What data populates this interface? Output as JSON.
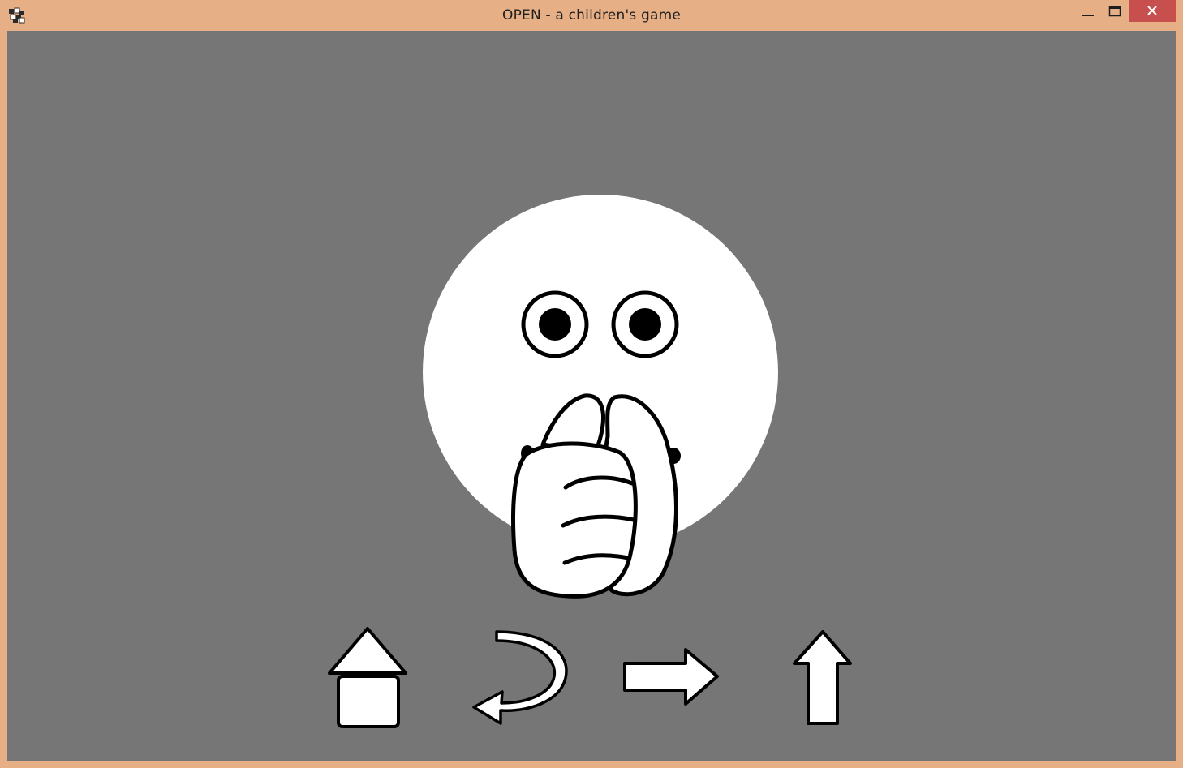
{
  "window": {
    "title": "OPEN - a children's game",
    "controls": [
      "minimize",
      "maximize",
      "close"
    ],
    "accent_color": "#e6af86",
    "close_color": "#c7504f"
  },
  "game": {
    "background_color": "#767676",
    "scene": "face-with-hands-over-mouth",
    "controls": [
      {
        "name": "home",
        "icon": "home-icon"
      },
      {
        "name": "back",
        "icon": "curved-back-arrow-icon"
      },
      {
        "name": "next",
        "icon": "right-arrow-icon"
      },
      {
        "name": "up",
        "icon": "up-arrow-icon"
      }
    ]
  }
}
